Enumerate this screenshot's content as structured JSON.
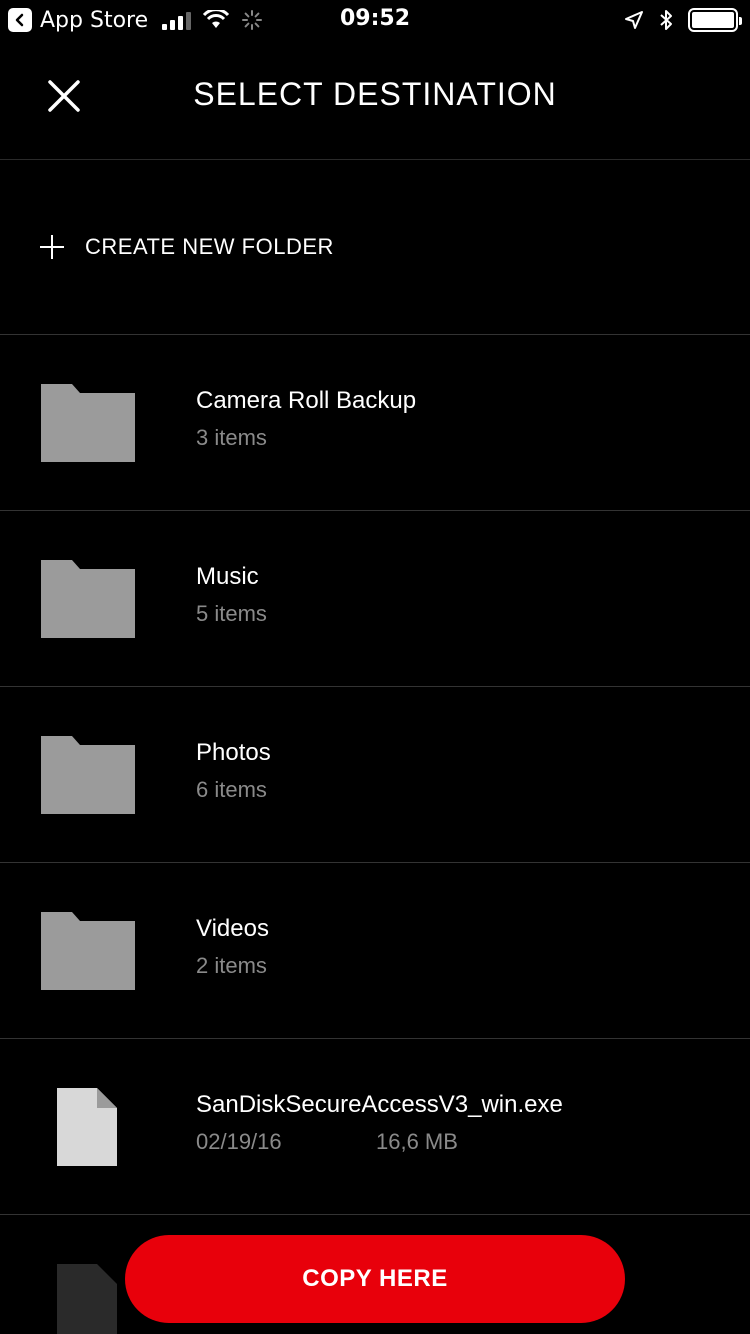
{
  "status_bar": {
    "back_app": "App Store",
    "time": "09:52"
  },
  "header": {
    "title": "SELECT DESTINATION"
  },
  "create_folder": {
    "label": "CREATE NEW FOLDER"
  },
  "items": [
    {
      "kind": "folder",
      "name": "Camera Roll Backup",
      "meta": "3 items"
    },
    {
      "kind": "folder",
      "name": "Music",
      "meta": "5 items"
    },
    {
      "kind": "folder",
      "name": "Photos",
      "meta": "6 items"
    },
    {
      "kind": "folder",
      "name": "Videos",
      "meta": "2 items"
    },
    {
      "kind": "file",
      "name": "SanDiskSecureAccessV3_win.exe",
      "date": "02/19/16",
      "size": "16,6 MB"
    }
  ],
  "copy_button": {
    "label": "COPY HERE"
  },
  "colors": {
    "accent": "#e8000b",
    "folder": "#9b9b9b",
    "file": "#d8d8d8",
    "background": "#000000"
  }
}
